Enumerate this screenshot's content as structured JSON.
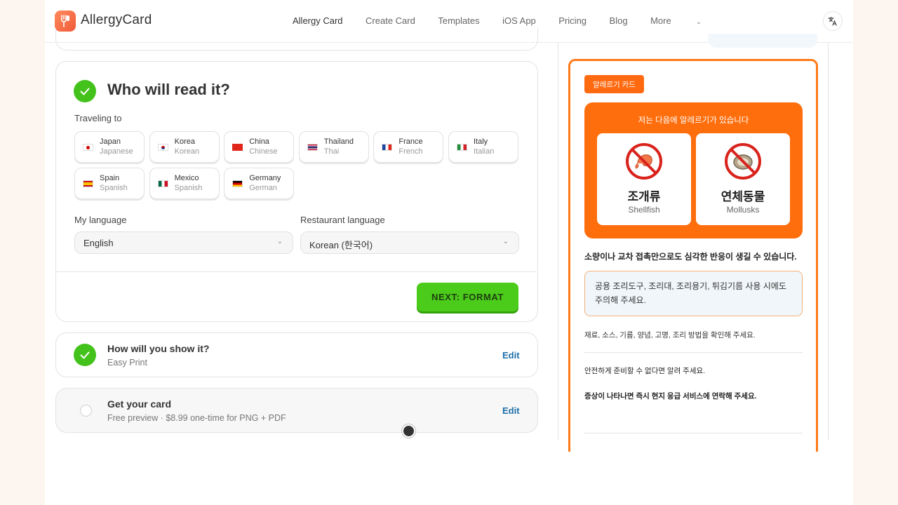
{
  "header": {
    "brand": "AllergyCard",
    "nav": [
      "Allergy Card",
      "Create Card",
      "Templates",
      "iOS App",
      "Pricing",
      "Blog",
      "More"
    ],
    "translate_icon": "translate-icon"
  },
  "step_who": {
    "title": "Who will read it?",
    "traveling_label": "Traveling to",
    "countries": [
      {
        "name": "Japan",
        "lang": "Japanese",
        "flag": "japan-flag-icon"
      },
      {
        "name": "Korea",
        "lang": "Korean",
        "flag": "korea-flag-icon"
      },
      {
        "name": "China",
        "lang": "Chinese",
        "flag": "china-flag-icon"
      },
      {
        "name": "Thailand",
        "lang": "Thai",
        "flag": "thailand-flag-icon"
      },
      {
        "name": "France",
        "lang": "French",
        "flag": "france-flag-icon"
      },
      {
        "name": "Italy",
        "lang": "Italian",
        "flag": "italy-flag-icon"
      },
      {
        "name": "Spain",
        "lang": "Spanish",
        "flag": "spain-flag-icon"
      },
      {
        "name": "Mexico",
        "lang": "Spanish",
        "flag": "mexico-flag-icon"
      },
      {
        "name": "Germany",
        "lang": "German",
        "flag": "germany-flag-icon"
      }
    ],
    "my_language_label": "My language",
    "my_language_value": "English",
    "restaurant_language_label": "Restaurant language",
    "restaurant_language_value": "Korean (한국어)",
    "next_button": "NEXT: FORMAT"
  },
  "step_show": {
    "title": "How will you show it?",
    "subtitle": "Easy Print",
    "edit": "Edit"
  },
  "step_get": {
    "title": "Get your card",
    "subtitle": "Free preview · $8.99 one-time for PNG + PDF",
    "edit": "Edit"
  },
  "preview": {
    "pill": "알레르기 카드",
    "header": "저는 다음에 알레르기가 있습니다",
    "allergens": [
      {
        "ko": "조개류",
        "en": "Shellfish",
        "icon": "no-shrimp-icon"
      },
      {
        "ko": "연체동물",
        "en": "Mollusks",
        "icon": "no-oyster-icon"
      }
    ],
    "warning": "소량이나 교차 접촉만으로도 심각한 반응이 생길 수 있습니다.",
    "note": "공용 조리도구, 조리대, 조리용기, 튀김기름 사용 시에도 주의해 주세요.",
    "line1": "재료, 소스, 기름, 양념, 고명, 조리 방법을 확인해 주세요.",
    "line2": "안전하게 준비할 수 없다면 알려 주세요.",
    "line3": "증상이 나타나면 즉시 현지 응급 서비스에 연락해 주세요."
  },
  "colors": {
    "accent_green": "#44c21c",
    "card_orange": "#ff6e0d",
    "edit_blue": "#1f6fa8"
  }
}
